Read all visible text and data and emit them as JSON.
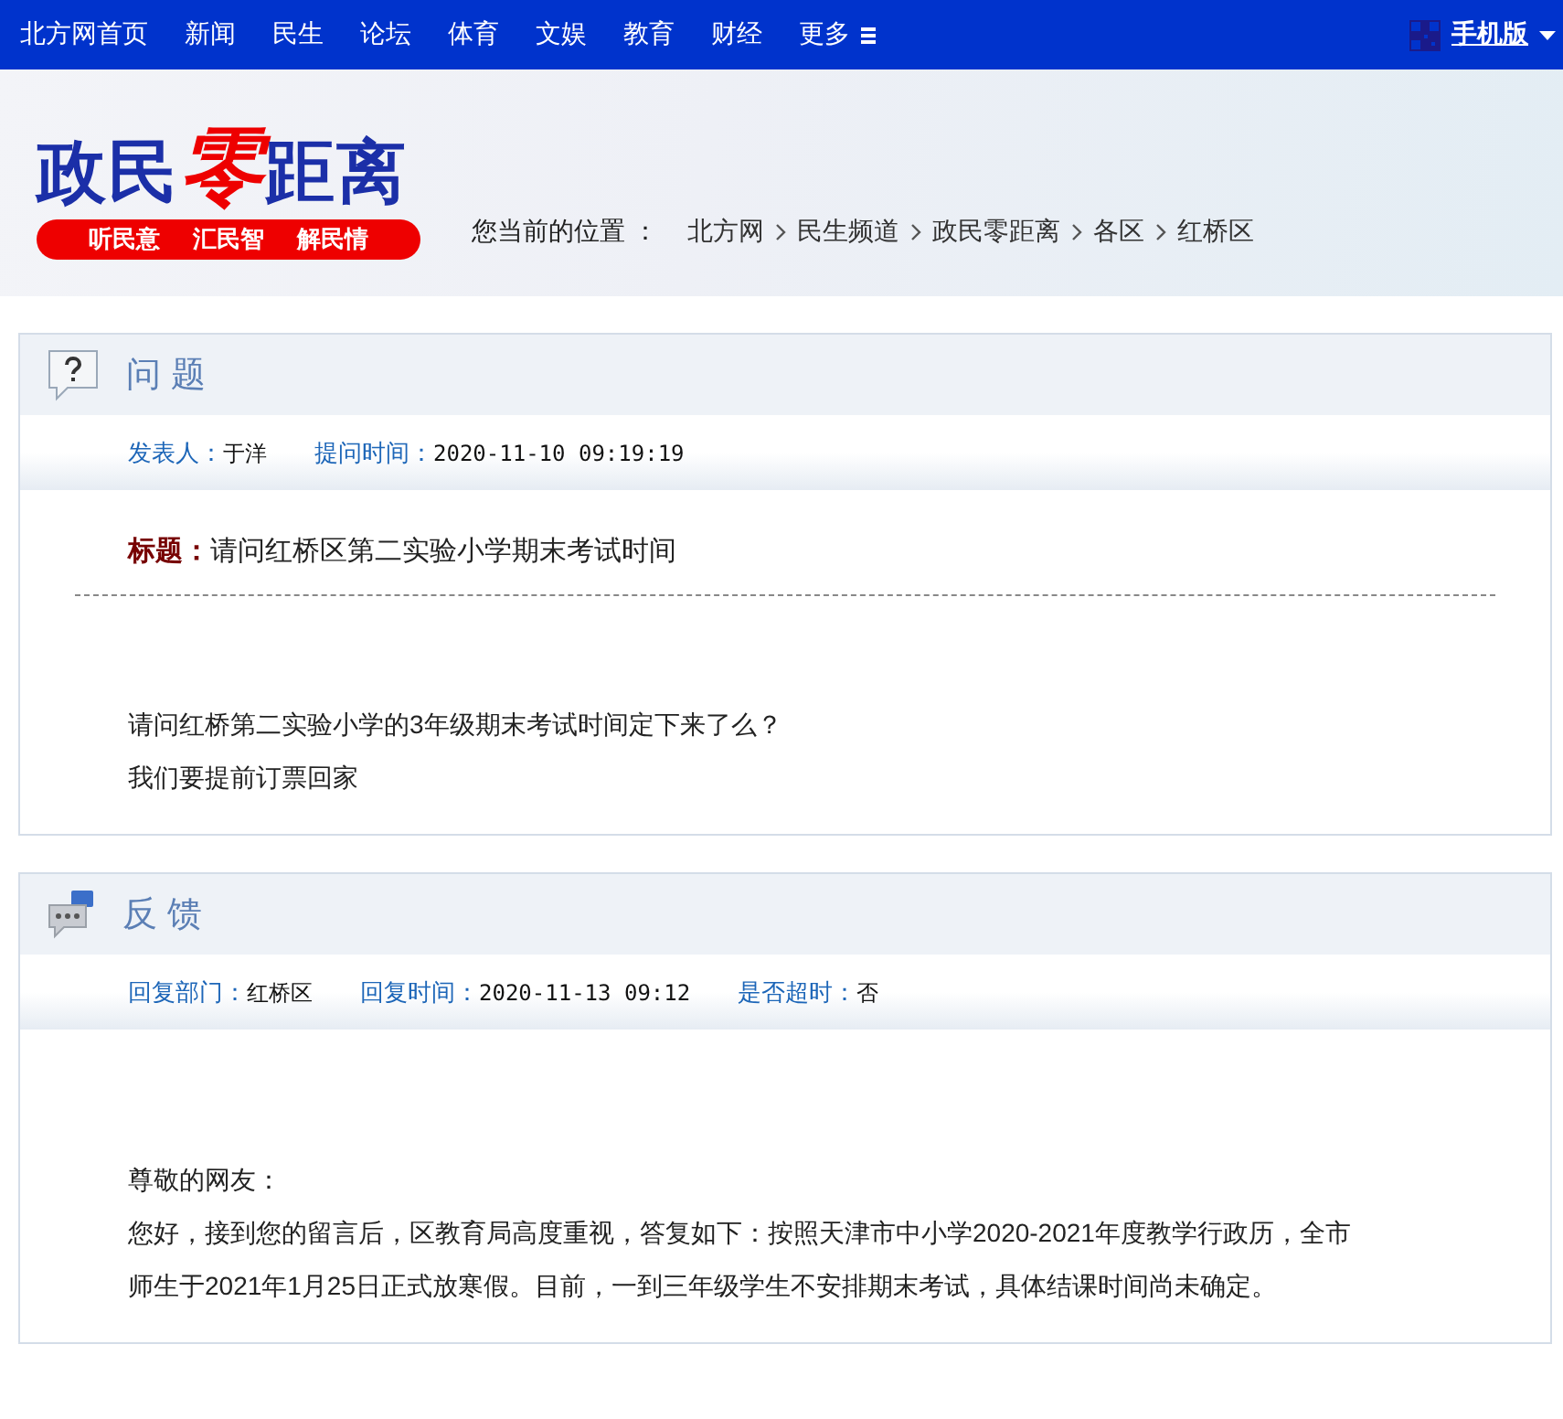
{
  "nav": {
    "items": [
      {
        "label": "北方网首页"
      },
      {
        "label": "新闻"
      },
      {
        "label": "民生"
      },
      {
        "label": "论坛"
      },
      {
        "label": "体育"
      },
      {
        "label": "文娱"
      },
      {
        "label": "教育"
      },
      {
        "label": "财经"
      },
      {
        "label": "更多",
        "kind": "menu"
      }
    ],
    "mobile": "手机版"
  },
  "banner": {
    "logo": {
      "left": "政民",
      "accent": "零",
      "right": "距离"
    },
    "slogans": [
      "听民意",
      "汇民智",
      "解民情"
    ],
    "location_label": "您当前的位置 ：",
    "breadcrumb": [
      "北方网",
      "民生频道",
      "政民零距离",
      "各区",
      "红桥区"
    ]
  },
  "sections": [
    {
      "kind": "question",
      "title": "问 题",
      "meta": [
        {
          "label": "发表人：",
          "value": "于洋"
        },
        {
          "label": "提问时间：",
          "value": "2020-11-10 09:19:19"
        }
      ],
      "subject_label": "标题：",
      "subject": "请问红桥区第二实验小学期末考试时间",
      "paragraphs": [
        "请问红桥第二实验小学的3年级期末考试时间定下来了么？",
        "我们要提前订票回家"
      ]
    },
    {
      "kind": "reply",
      "title": "反 馈",
      "meta": [
        {
          "label": "回复部门：",
          "value": "红桥区"
        },
        {
          "label": "回复时间：",
          "value": "2020-11-13 09:12"
        },
        {
          "label": "是否超时：",
          "value": "否"
        }
      ],
      "paragraphs": [
        "尊敬的网友：",
        "您好，接到您的留言后，区教育局高度重视，答复如下：按照天津市中小学2020-2021年度教学行政历，全市师生于2021年1月25日正式放寒假。目前，一到三年级学生不安排期末考试，具体结课时间尚未确定。"
      ]
    }
  ]
}
